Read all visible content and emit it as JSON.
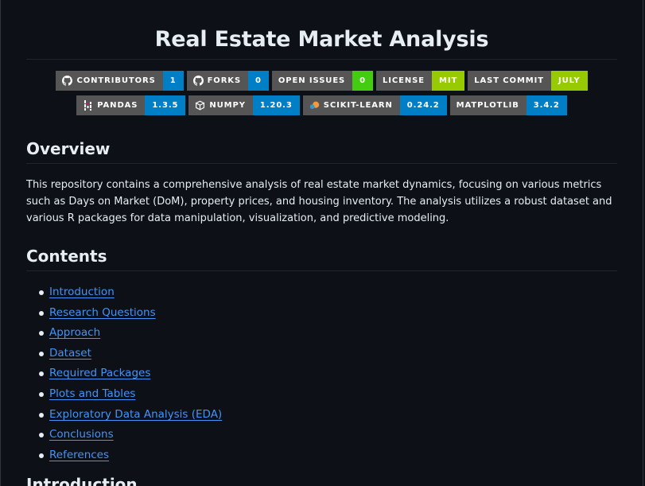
{
  "readme": {
    "title": "Real Estate Market Analysis",
    "badges_row1": [
      {
        "icon": "github-icon",
        "label": "CONTRIBUTORS",
        "value": "1",
        "color": "#007ec6"
      },
      {
        "icon": "github-icon",
        "label": "FORKS",
        "value": "0",
        "color": "#007ec6"
      },
      {
        "icon": null,
        "label": "OPEN ISSUES",
        "value": "0",
        "color": "#4c1"
      },
      {
        "icon": null,
        "label": "LICENSE",
        "value": "MIT",
        "color": "#97ca00"
      },
      {
        "icon": null,
        "label": "LAST COMMIT",
        "value": "JULY",
        "color": "#97ca00"
      }
    ],
    "badges_row2": [
      {
        "icon": "pandas-icon",
        "label": "PANDAS",
        "value": "1.3.5",
        "color": "#007ec6"
      },
      {
        "icon": "numpy-icon",
        "label": "NUMPY",
        "value": "1.20.3",
        "color": "#007ec6"
      },
      {
        "icon": "scikit-learn-icon",
        "label": "SCIKIT-LEARN",
        "value": "0.24.2",
        "color": "#007ec6"
      },
      {
        "icon": null,
        "label": "MATPLOTLIB",
        "value": "3.4.2",
        "color": "#007ec6"
      }
    ],
    "overview": {
      "heading": "Overview",
      "text": "This repository contains a comprehensive analysis of real estate market dynamics, focusing on various metrics such as Days on Market (DoM), property prices, and housing inventory. The analysis utilizes a robust dataset and various R packages for data manipulation, visualization, and predictive modeling."
    },
    "contents": {
      "heading": "Contents",
      "items": [
        "Introduction",
        "Research Questions",
        "Approach",
        "Dataset",
        "Required Packages",
        "Plots and Tables",
        "Exploratory Data Analysis (EDA)",
        "Conclusions",
        "References"
      ]
    },
    "next_heading": "Introduction"
  }
}
